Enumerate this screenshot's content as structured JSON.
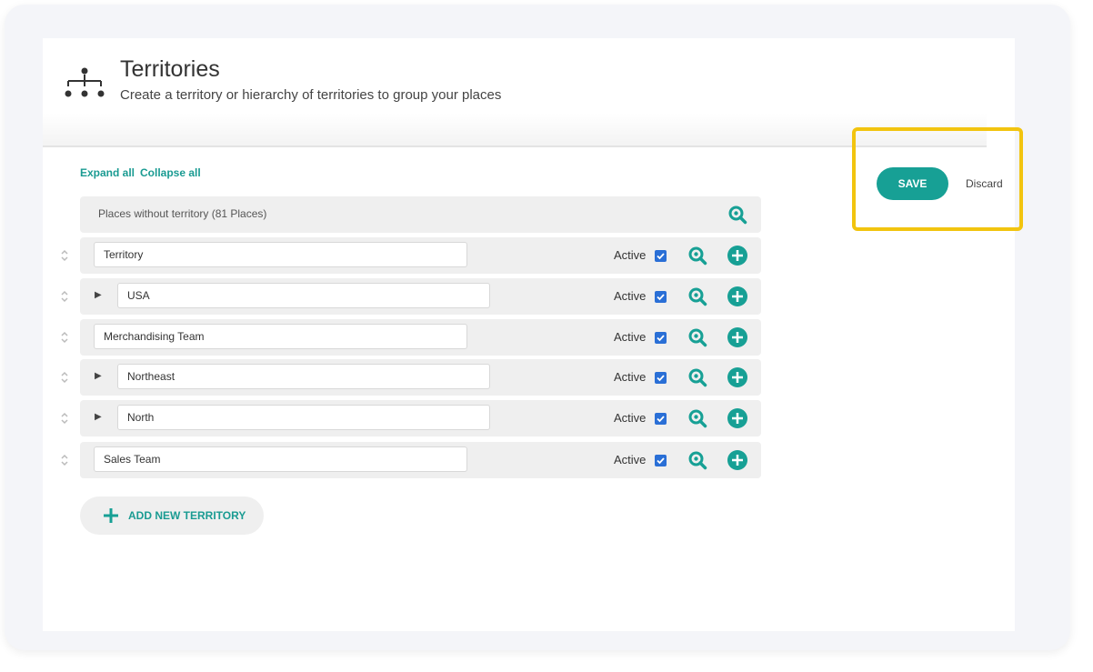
{
  "header": {
    "title": "Territories",
    "subtitle": "Create a territory or hierarchy of territories to group your places"
  },
  "toolbar": {
    "expand_all": "Expand all",
    "collapse_all": "Collapse all"
  },
  "places_without_territory": "Places without territory (81 Places)",
  "territories": [
    {
      "name": "Territory",
      "active_label": "Active",
      "active": true,
      "has_children": false
    },
    {
      "name": "USA",
      "active_label": "Active",
      "active": true,
      "has_children": true
    },
    {
      "name": "Merchandising Team",
      "active_label": "Active",
      "active": true,
      "has_children": false
    },
    {
      "name": "Northeast",
      "active_label": "Active",
      "active": true,
      "has_children": true
    },
    {
      "name": "North",
      "active_label": "Active",
      "active": true,
      "has_children": true
    },
    {
      "name": "Sales Team",
      "active_label": "Active",
      "active": true,
      "has_children": false
    }
  ],
  "add_territory_label": "ADD NEW TERRITORY",
  "actions": {
    "save_label": "SAVE",
    "discard_label": "Discard"
  },
  "icons": {
    "logo": "hierarchy-icon",
    "search": "search-icon",
    "add": "plus-circle-icon",
    "drag": "drag-handle-icon",
    "expand": "expand-arrow-icon",
    "checkbox": "checkbox-checked-icon"
  },
  "colors": {
    "accent": "#17a095",
    "highlight": "#f2c40f",
    "checkbox": "#2a6fd6"
  }
}
